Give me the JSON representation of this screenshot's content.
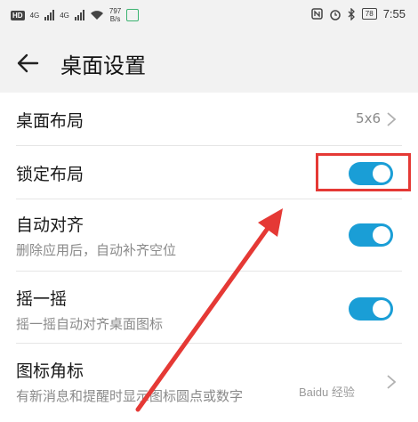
{
  "status_bar": {
    "badge": "HD",
    "signal1": "4G",
    "signal2": "4G",
    "speed_value": "797",
    "speed_unit": "B/s",
    "battery": "78",
    "time": "7:55"
  },
  "header": {
    "title": "桌面设置"
  },
  "settings": {
    "layout": {
      "title": "桌面布局",
      "value": "5x6"
    },
    "lock_layout": {
      "title": "锁定布局",
      "enabled": true
    },
    "auto_align": {
      "title": "自动对齐",
      "subtitle": "删除应用后，自动补齐空位",
      "enabled": true
    },
    "shake": {
      "title": "摇一摇",
      "subtitle": "摇一摇自动对齐桌面图标",
      "enabled": true
    },
    "badges": {
      "title": "图标角标",
      "subtitle": "有新消息和提醒时显示图标圆点或数字"
    }
  },
  "watermark": "Baidu 经验",
  "colors": {
    "accent": "#1a9ed6",
    "highlight": "#e53935"
  }
}
